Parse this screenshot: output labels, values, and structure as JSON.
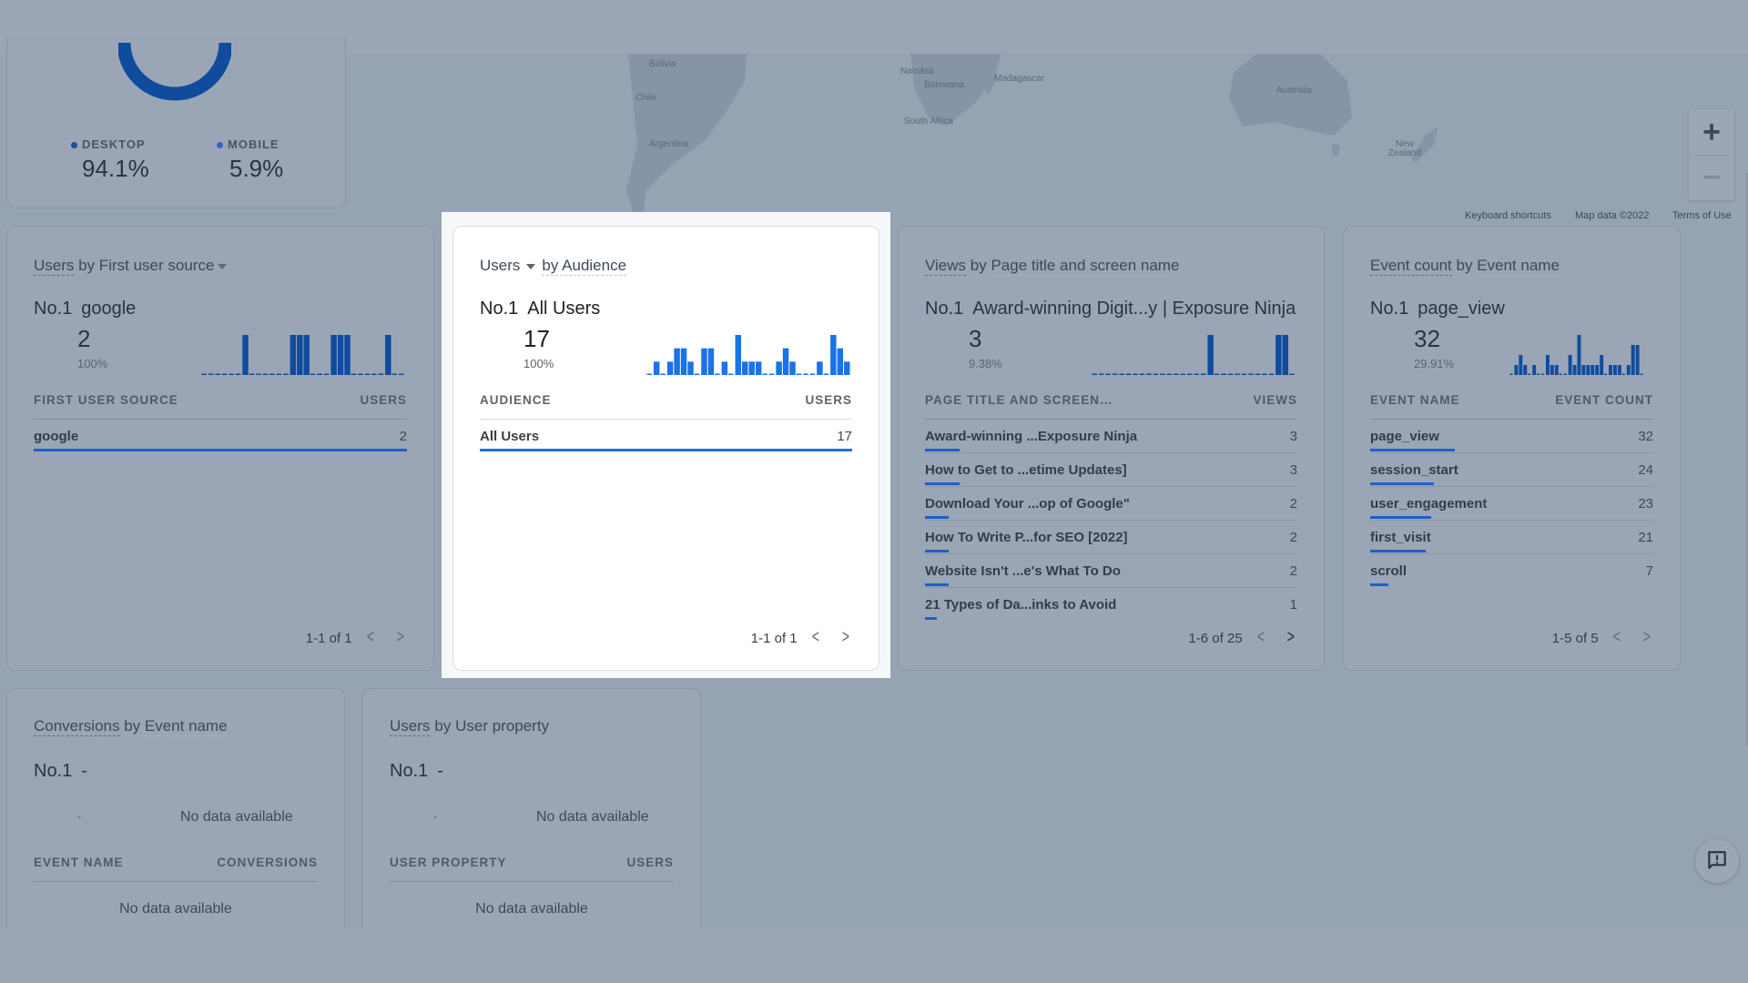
{
  "map": {
    "labels": [
      "Bolivia",
      "Chile",
      "Argentina",
      "Namibia",
      "Botswana",
      "South Africa",
      "Madagascar",
      "Australia",
      "New Zealand"
    ],
    "zoom_in_icon": "plus-icon",
    "zoom_out_icon": "minus-icon",
    "footer": {
      "keyboard_shortcuts": "Keyboard shortcuts",
      "map_data": "Map data ©2022",
      "terms": "Terms of Use"
    }
  },
  "device_card": {
    "legend": [
      {
        "label": "DESKTOP",
        "value": "94.1%",
        "color": "#1a4fa0"
      },
      {
        "label": "MOBILE",
        "value": "5.9%",
        "color": "#2f66c7"
      }
    ],
    "donut_share_desktop": 0.941
  },
  "cards": [
    {
      "title_metric": "Users",
      "title_rest": " by First user source",
      "has_dropdown_after_title": true,
      "no_label": "No.1",
      "top_name": "google",
      "top_value": "2",
      "top_pct": "100%",
      "sparkline": [
        0,
        0,
        0,
        0,
        0,
        0,
        1,
        0,
        0,
        0,
        0,
        0,
        0,
        1,
        1,
        1,
        0,
        0,
        0,
        1,
        1,
        1,
        0,
        0,
        0,
        0,
        0,
        1,
        0,
        0
      ],
      "col_dim": "FIRST USER SOURCE",
      "col_metric": "USERS",
      "rows": [
        {
          "name": "google",
          "value": "2",
          "share": 1.0
        }
      ],
      "pager": "1-1 of 1"
    },
    {
      "title_metric": "Users",
      "title_rest": "by Audience",
      "has_dropdown_after_metric": true,
      "no_label": "No.1",
      "top_name": "All Users",
      "top_value": "17",
      "top_pct": "100%",
      "sparkline": [
        0,
        1,
        0,
        1,
        2,
        2,
        1,
        0,
        2,
        2,
        0,
        1,
        0,
        3,
        1,
        1,
        1,
        0,
        0,
        1,
        2,
        1,
        0,
        0,
        0,
        1,
        0,
        3,
        2,
        1
      ],
      "col_dim": "AUDIENCE",
      "col_metric": "USERS",
      "rows": [
        {
          "name": "All Users",
          "value": "17",
          "share": 1.0
        }
      ],
      "pager": "1-1 of 1"
    },
    {
      "title_metric": "Views",
      "title_rest": "Page title and screen name",
      "no_label": "No.1",
      "top_name": "Award-winning Digit...y | Exposure Ninja",
      "top_value": "3",
      "top_pct": "9.38%",
      "sparkline": [
        0,
        0,
        0,
        0,
        0,
        0,
        0,
        0,
        0,
        0,
        0,
        0,
        0,
        0,
        0,
        0,
        0,
        1,
        0,
        0,
        0,
        0,
        0,
        0,
        0,
        0,
        0,
        1,
        1,
        0
      ],
      "col_dim": "PAGE TITLE AND SCREEN…",
      "col_metric": "VIEWS",
      "rows": [
        {
          "name": "Award-winning ...Exposure Ninja",
          "value": "3",
          "share": 0.094
        },
        {
          "name": "How to Get to ...etime Updates]",
          "value": "3",
          "share": 0.094
        },
        {
          "name": "Download Your ...op of Google\"",
          "value": "2",
          "share": 0.0625
        },
        {
          "name": "How To Write P...for SEO [2022]",
          "value": "2",
          "share": 0.0625
        },
        {
          "name": "Website Isn't ...e's What To Do",
          "value": "2",
          "share": 0.0625
        },
        {
          "name": "21 Types of Da...inks to Avoid",
          "value": "1",
          "share": 0.031
        }
      ],
      "pager": "1-6 of 25"
    },
    {
      "title_metric": "Event count",
      "title_rest": "Event name",
      "no_label": "No.1",
      "top_name": "page_view",
      "top_value": "32",
      "top_pct": "29.91%",
      "sparkline": [
        0,
        1,
        2,
        1,
        0,
        1,
        0,
        0,
        2,
        1,
        1,
        0,
        0,
        2,
        1,
        4,
        1,
        1,
        1,
        1,
        2,
        0,
        1,
        1,
        1,
        0,
        1,
        3,
        3,
        0
      ],
      "col_dim": "EVENT NAME",
      "col_metric": "EVENT COUNT",
      "rows": [
        {
          "name": "page_view",
          "value": "32",
          "share": 0.299
        },
        {
          "name": "session_start",
          "value": "24",
          "share": 0.224
        },
        {
          "name": "user_engagement",
          "value": "23",
          "share": 0.215
        },
        {
          "name": "first_visit",
          "value": "21",
          "share": 0.196
        },
        {
          "name": "scroll",
          "value": "7",
          "share": 0.065
        }
      ],
      "pager": "1-5 of 5"
    }
  ],
  "empty_cards": [
    {
      "title_metric": "Conversions",
      "title_rest": "Event name",
      "no_label": "No.1",
      "top_name": "-",
      "top_value": "-",
      "chart_nodata": "No data available",
      "col_dim": "EVENT NAME",
      "col_metric": "CONVERSIONS",
      "table_nodata": "No data available"
    },
    {
      "title_metric": "Users",
      "title_rest": "by User property",
      "no_label": "No.1",
      "top_name": "-",
      "top_value": "-",
      "chart_nodata": "No data available",
      "col_dim": "USER PROPERTY",
      "col_metric": "USERS",
      "table_nodata": "No data available"
    }
  ],
  "common": {
    "by": " by "
  },
  "feedback_icon": "feedback-icon"
}
